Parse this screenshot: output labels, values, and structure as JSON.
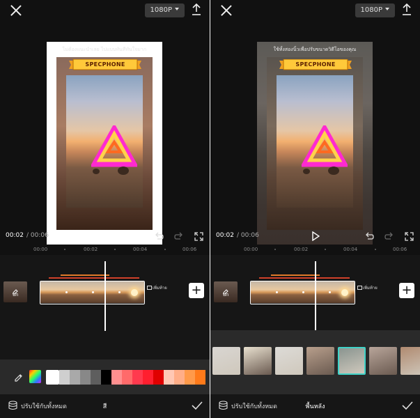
{
  "left": {
    "resolution": "1080P",
    "canvas_caption": "ไม่ต้องแนะนำเลย ไปแบบทันทีทันใจมาก",
    "banner_text": "SPECPHONE",
    "time_current": "00:02",
    "time_total": " / 00:06",
    "ruler_ticks": [
      "00:00",
      "00:02",
      "00:04",
      "00:06"
    ],
    "cover_label": "ปก",
    "ending_label": "เพิ่มท้าย",
    "add_label": "+",
    "swatch_colors": [
      "#ffffff",
      "#cfcfcf",
      "#a9a9a9",
      "#888888",
      "#5e5e5e",
      "#000000",
      "#ff8f8f",
      "#ff6a6a",
      "#ff3a4e",
      "#ff1f2f",
      "#e00000",
      "#ffc8b4",
      "#ffae88",
      "#ff9a4a",
      "#ff7a1a"
    ],
    "apply_all": "ปรับใช้กับทั้งหมด",
    "footer_title": "สี"
  },
  "right": {
    "resolution": "1080P",
    "canvas_caption": "ใช้ทั้งสองนิ้วเพื่อปรับขนาดวิดีโอของคุณ",
    "banner_text": "SPECPHONE",
    "time_current": "00:02",
    "time_total": " / 00:06",
    "ruler_ticks": [
      "00:00",
      "00:02",
      "00:04",
      "00:06"
    ],
    "cover_label": "ปก",
    "ending_label": "เพิ่มท้าย",
    "add_label": "+",
    "bg_thumb_colors": [
      "#d9d6d2",
      "#e8e0cf",
      "#dddbd7",
      "#b89f8c",
      "#8a9590",
      "#b8a59a",
      "#b08a70"
    ],
    "apply_all": "ปรับใช้กับทั้งหมด",
    "footer_title": "พื้นหลัง"
  },
  "colors": {
    "accent_selected": "#3fd3c8",
    "audio_line_orange": "#e07a2a",
    "audio_line_red": "#d0402a"
  },
  "icons": [
    "close-icon",
    "export-icon",
    "play-icon",
    "undo-icon",
    "redo-icon",
    "fullscreen-icon",
    "pencil-icon",
    "eyedropper-icon",
    "layers-icon",
    "check-icon"
  ]
}
